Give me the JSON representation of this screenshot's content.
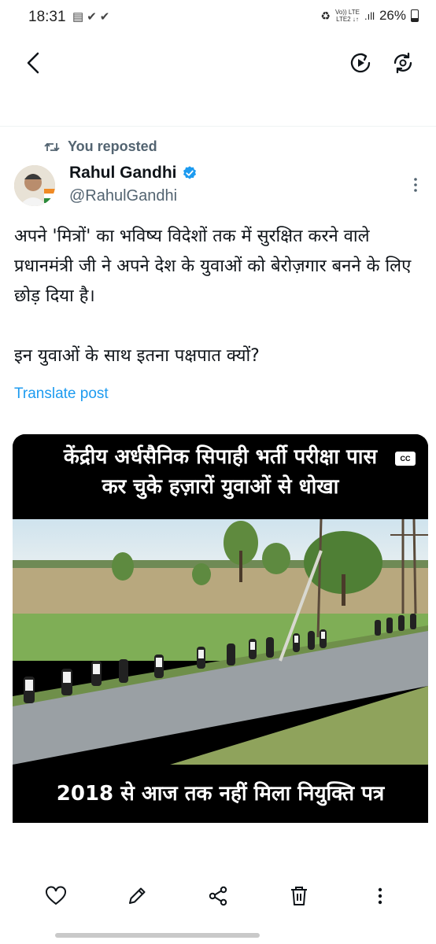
{
  "status_bar": {
    "time": "18:31",
    "left_icons": [
      "notes-icon",
      "check-icon",
      "check-icon"
    ],
    "network_top": "Vo)) LTE",
    "network_bottom": "LTE2 ↓↑",
    "battery": "26%"
  },
  "top_bar": {
    "icons": [
      "back-arrow-icon",
      "play-circle-icon",
      "refresh-icon"
    ]
  },
  "tweet": {
    "reposted_label": "You reposted",
    "author_name": "Rahul Gandhi",
    "author_handle": "@RahulGandhi",
    "verified": true,
    "text_p1": "अपने 'मित्रों' का भविष्य विदेशों तक में सुरक्षित करने वाले प्रधानमंत्री जी ने अपने देश के युवाओं को बेरोज़गार बनने के लिए छोड़ दिया है।",
    "text_p2": "इन युवाओं के साथ इतना पक्षपात क्यों?",
    "translate_label": "Translate post",
    "media": {
      "headline_line1": "केंद्रीय अर्धसैनिक सिपाही भर्ती परीक्षा पास",
      "headline_line2": "कर चुके हज़ारों युवाओं से धोखा",
      "footer_text": "2018 से आज तक नहीं मिला नियुक्ति पत्र",
      "cc_badge": "CC"
    }
  },
  "action_bar": {
    "icons": [
      "heart-icon",
      "edit-icon",
      "share-icon",
      "delete-icon",
      "more-vertical-icon"
    ]
  },
  "colors": {
    "accent": "#1d9bf0",
    "text_primary": "#0f1419",
    "text_secondary": "#536471"
  }
}
